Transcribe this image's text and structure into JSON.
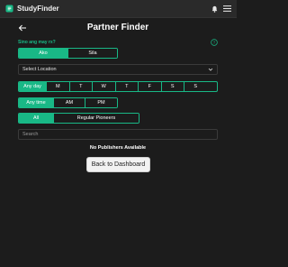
{
  "app": {
    "brand": "StudyFinder",
    "icons": [
      "app-logo-icon",
      "bell-icon",
      "menu-icon"
    ]
  },
  "colors": {
    "accent": "#19b886",
    "background": "#1c1c1c",
    "topbar": "#2a2a2a"
  },
  "page": {
    "title": "Partner Finder",
    "question": "Sino ang may rx?",
    "who_options": [
      {
        "label": "Ako",
        "active": true
      },
      {
        "label": "Sila",
        "active": false
      }
    ],
    "location_select": {
      "value": "Select Location"
    },
    "day_options": [
      {
        "label": "Any day",
        "active": true
      },
      {
        "label": "M",
        "active": false
      },
      {
        "label": "T",
        "active": false
      },
      {
        "label": "W",
        "active": false
      },
      {
        "label": "T",
        "active": false
      },
      {
        "label": "F",
        "active": false
      },
      {
        "label": "S",
        "active": false
      },
      {
        "label": "S",
        "active": false
      }
    ],
    "time_options": [
      {
        "label": "Any time",
        "active": true
      },
      {
        "label": "AM",
        "active": false
      },
      {
        "label": "PM",
        "active": false
      }
    ],
    "pioneer_options": [
      {
        "label": "All",
        "active": true
      },
      {
        "label": "Regular Pioneers",
        "active": false
      }
    ],
    "search": {
      "placeholder": "Search",
      "value": ""
    },
    "empty_message": "No Publishers Available",
    "back_button": "Back to Dashboard"
  }
}
